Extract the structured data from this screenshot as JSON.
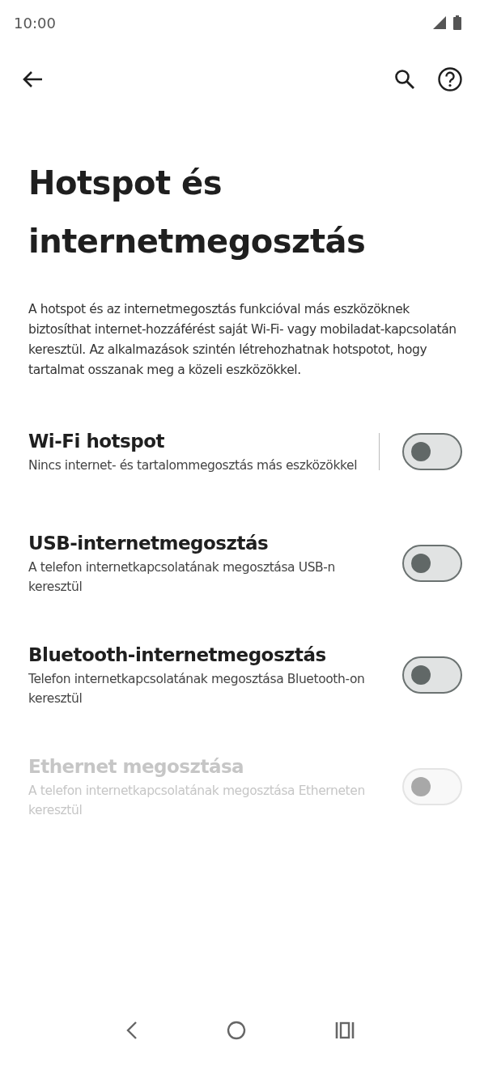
{
  "status_bar": {
    "time": "10:00"
  },
  "title": "Hotspot és internetmegosztás",
  "description": "A hotspot és az internetmegosztás funkcióval más eszközöknek biztosíthat internet-hozzáférést saját Wi-Fi- vagy mobiladat-kapcsolatán keresztül. Az alkalmazások szintén létrehozhatnak hotspotot, hogy tartalmat osszanak meg a közeli eszközökkel.",
  "settings": [
    {
      "title": "Wi-Fi hotspot",
      "subtitle": "Nincs internet- és tartalommegosztás más eszközökkel",
      "on": false,
      "disabled": false,
      "divider": true
    },
    {
      "title": "USB-internetmegosztás",
      "subtitle": "A telefon internetkapcsolatának megosztása USB-n keresztül",
      "on": false,
      "disabled": false,
      "divider": false
    },
    {
      "title": "Bluetooth-internetmegosztás",
      "subtitle": "Telefon internetkapcsolatának megosztása Bluetooth-on keresztül",
      "on": false,
      "disabled": false,
      "divider": false
    },
    {
      "title": "Ethernet megosztása",
      "subtitle": "A telefon internetkapcsolatának megosztása Etherneten keresztül",
      "on": false,
      "disabled": true,
      "divider": false
    }
  ]
}
